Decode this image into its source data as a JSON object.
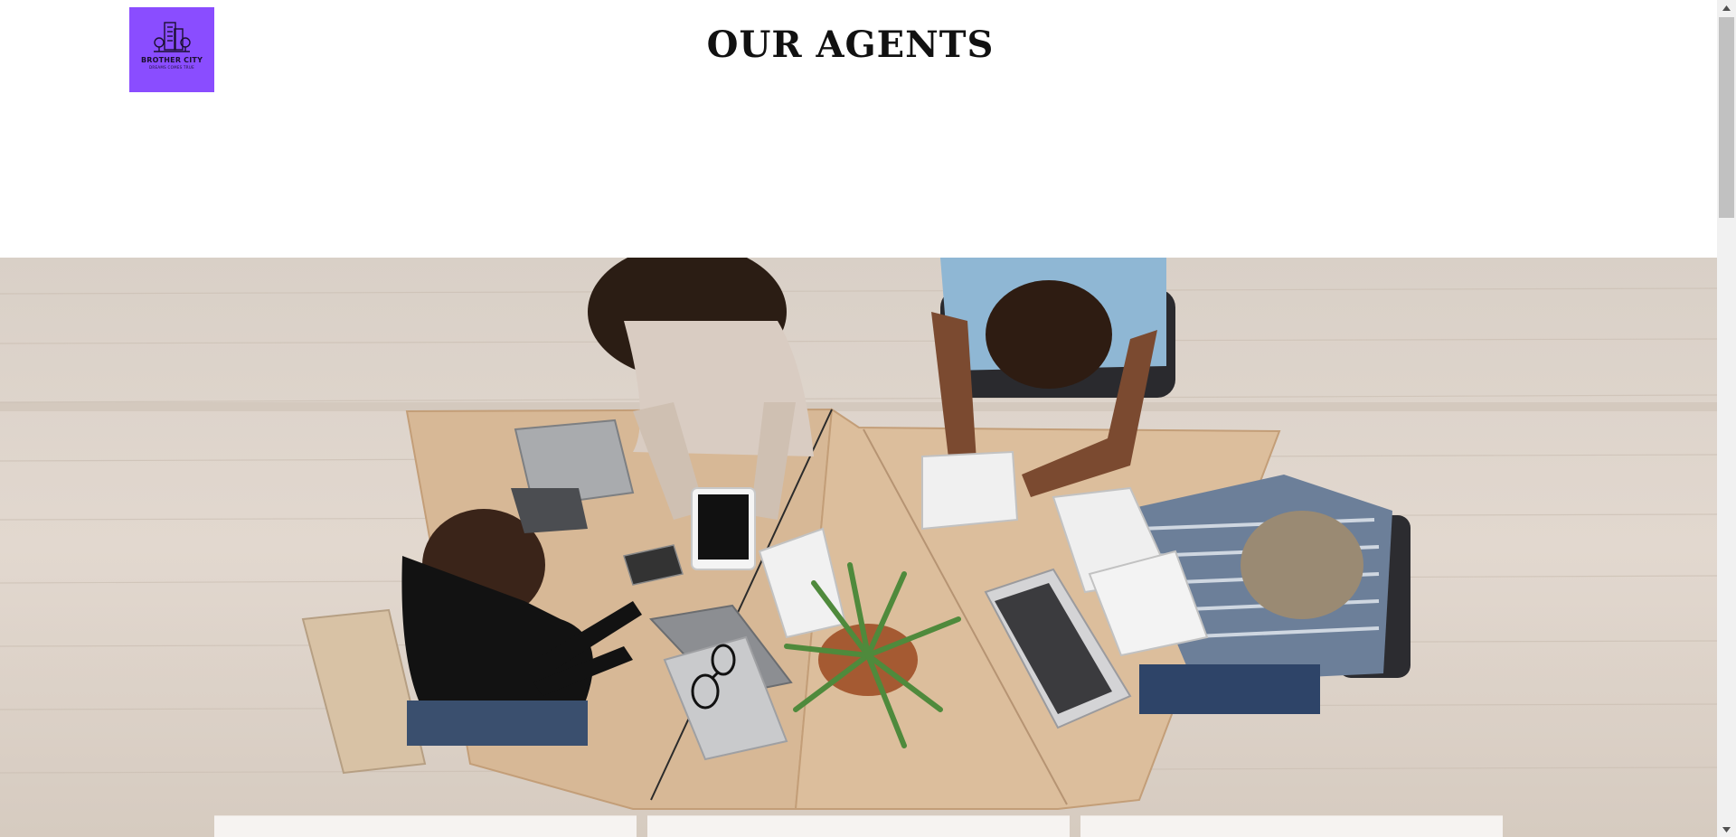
{
  "header": {
    "logo": {
      "name": "BROTHER CITY",
      "tagline": "DREAMS COMES TRUE",
      "background_color": "#8a4dff",
      "icon": "city-buildings-icon"
    },
    "title": "OUR AGENTS"
  },
  "hero": {
    "image": "team-meeting-photo",
    "description_icon": "photo"
  },
  "scrollbar": {
    "up_icon": "triangle-up-icon",
    "down_icon": "triangle-down-icon"
  }
}
